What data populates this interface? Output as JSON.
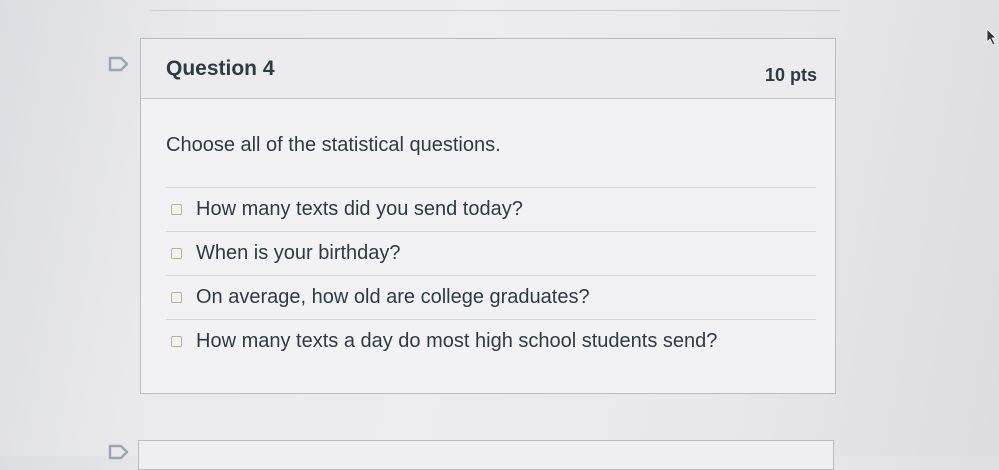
{
  "question": {
    "title": "Question 4",
    "points": "10 pts",
    "prompt": "Choose all of the statistical questions.",
    "answers": [
      {
        "label": "How many texts did you send today?",
        "checked": false
      },
      {
        "label": "When is your birthday?",
        "checked": false
      },
      {
        "label": "On average, how old are college graduates?",
        "checked": false
      },
      {
        "label": "How many texts a day do most high school students send?",
        "checked": false
      }
    ]
  },
  "icons": {
    "flag": "flag-question-icon",
    "cursor": "mouse-cursor-icon"
  },
  "colors": {
    "text": "#2d3b45",
    "flag_outline": "#9aa7b3"
  }
}
